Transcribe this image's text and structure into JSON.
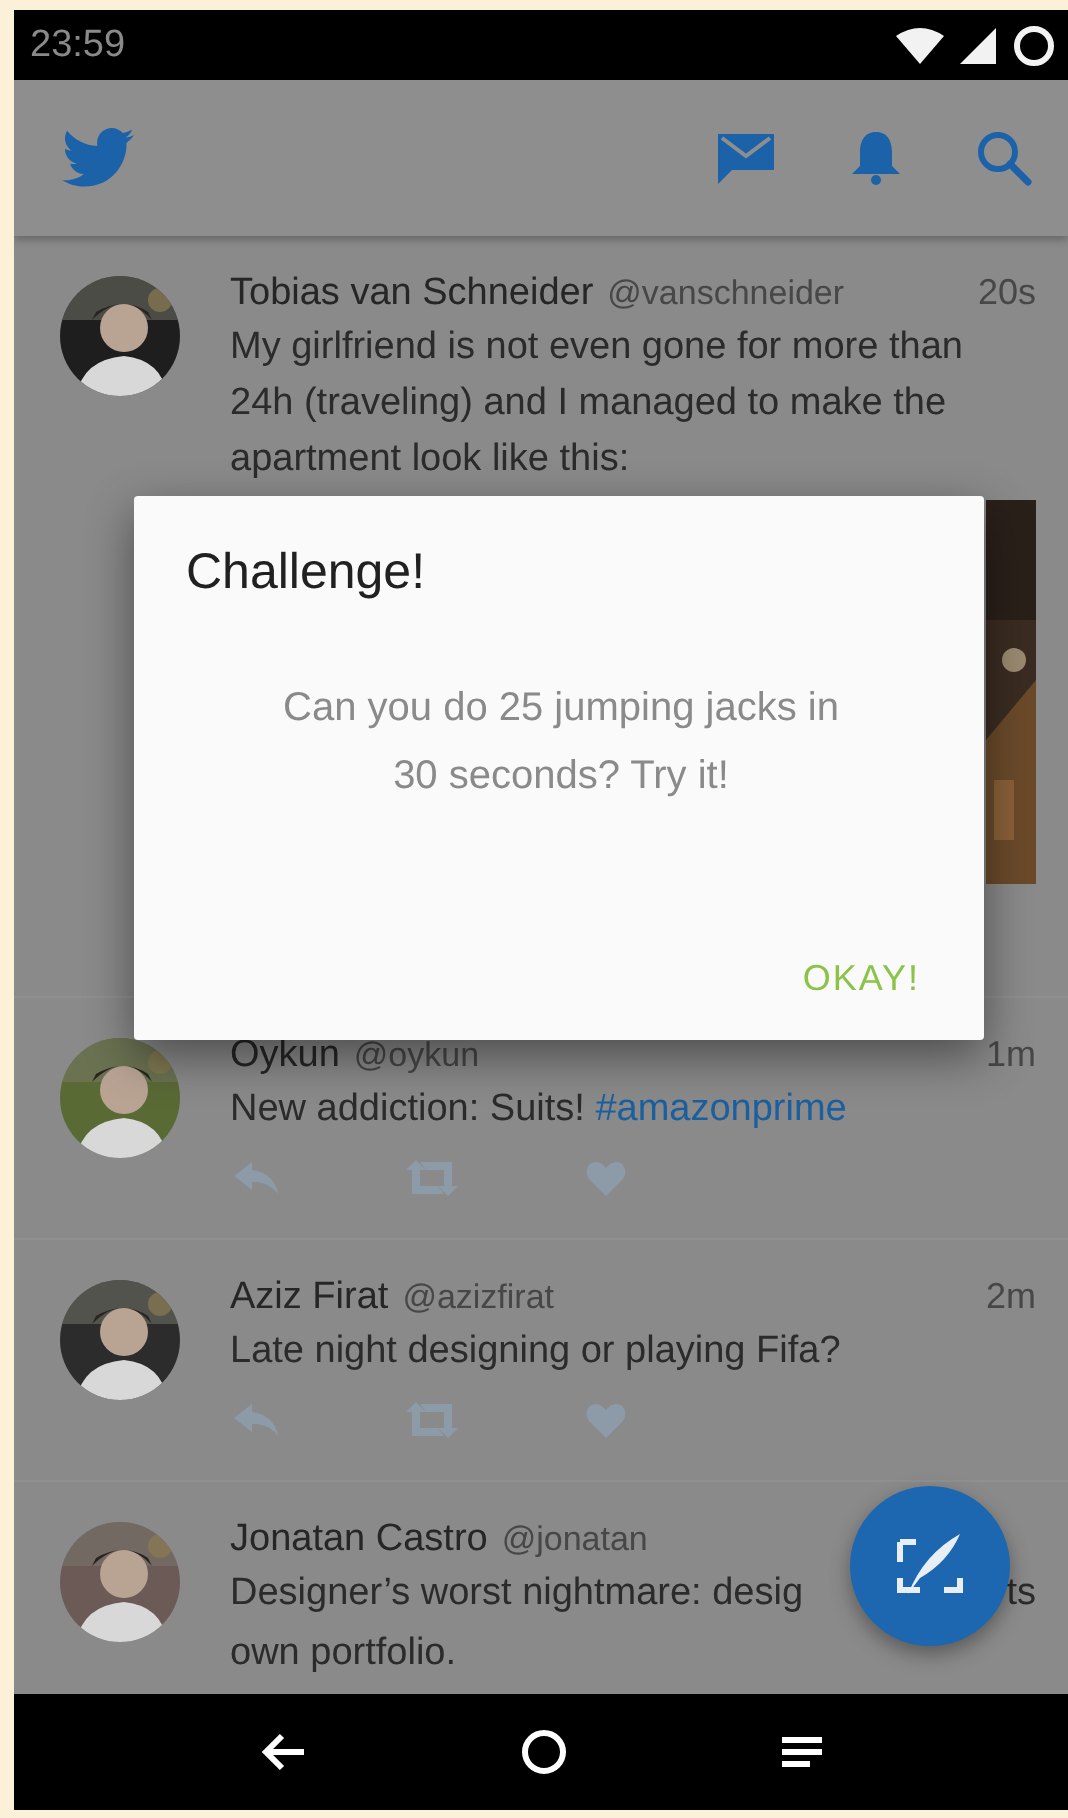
{
  "status_bar": {
    "time": "23:59"
  },
  "tweets": [
    {
      "name": "Tobias van Schneider",
      "handle": "@vanschneider",
      "time": "20s",
      "text": "My girlfriend is not even gone for more than 24h (traveling) and I managed to make the apartment look like this:"
    },
    {
      "name": "Oykun",
      "handle": "@oykun",
      "time": "1m",
      "text": "New addiction: Suits!",
      "hashtag": "#amazonprime"
    },
    {
      "name": "Aziz Firat",
      "handle": "@azizfirat",
      "time": "2m",
      "text": "Late night designing or playing Fifa?"
    },
    {
      "name": "Jonatan Castro",
      "handle": "@jonatan",
      "text": "Designer’s worst nightmare: desig",
      "text_tail": "ts",
      "text_next": "own portfolio."
    }
  ],
  "dialog": {
    "title": "Challenge!",
    "message": "Can you do 25 jumping jacks in 30 seconds? Try it!",
    "button": "OKAY!"
  }
}
